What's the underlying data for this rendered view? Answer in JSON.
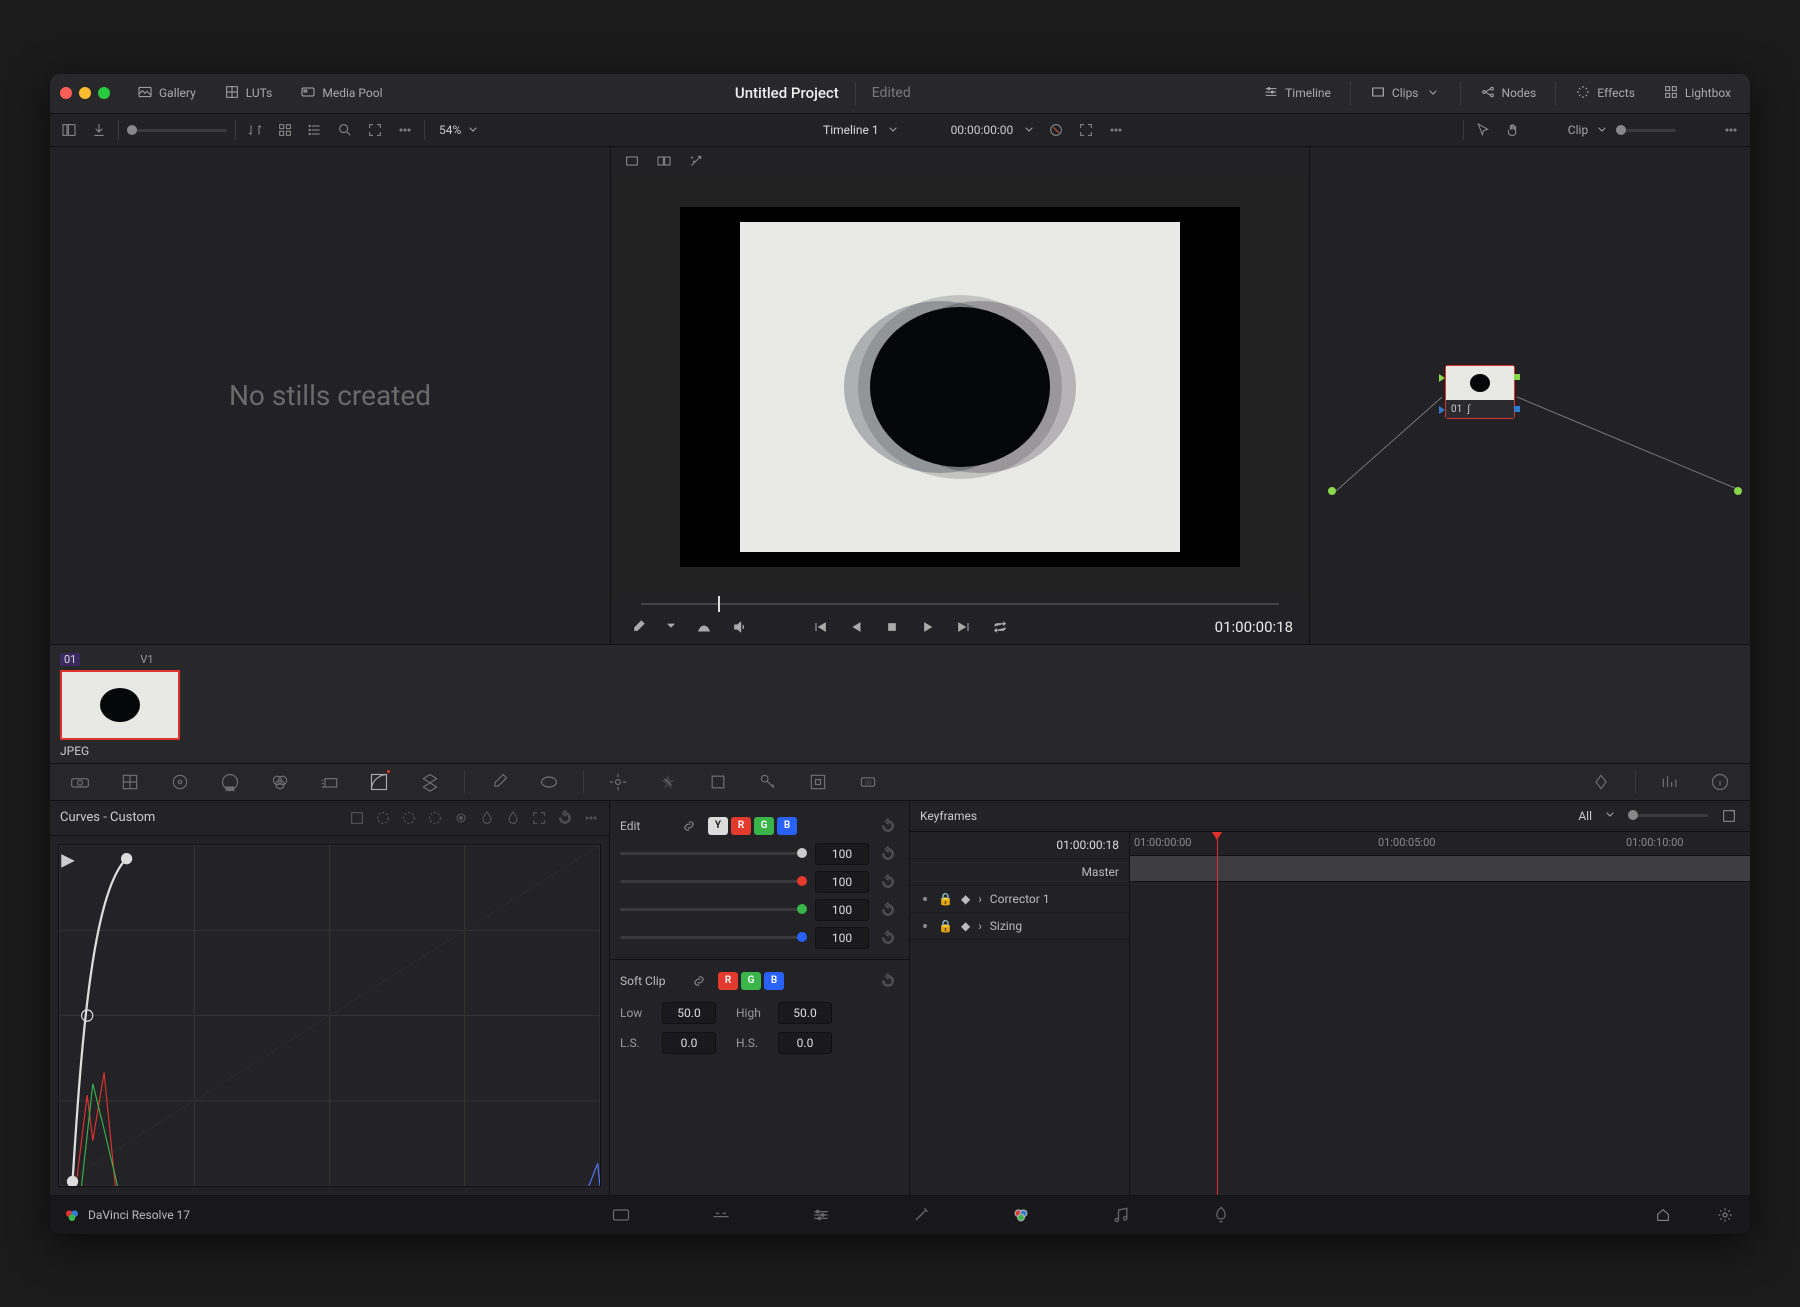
{
  "project": {
    "title": "Untitled Project",
    "status": "Edited"
  },
  "titlebar": {
    "gallery": "Gallery",
    "luts": "LUTs",
    "mediapool": "Media Pool",
    "timeline": "Timeline",
    "clips": "Clips",
    "nodes": "Nodes",
    "effects": "Effects",
    "lightbox": "Lightbox"
  },
  "subbar": {
    "zoom": "54%",
    "timeline_name": "Timeline 1",
    "clip_sel": "Clip",
    "timecode": "00:00:00:00"
  },
  "gallery": {
    "empty": "No stills created"
  },
  "viewer": {
    "tc": "01:00:00:18"
  },
  "node": {
    "id": "01"
  },
  "clipstrip": {
    "badge": "01",
    "track": "V1",
    "caption": "JPEG"
  },
  "curves": {
    "title": "Curves - Custom",
    "edit_label": "Edit",
    "softclip_label": "Soft Clip",
    "channels": [
      "Y",
      "R",
      "G",
      "B"
    ],
    "value_lum": "100",
    "value_r": "100",
    "value_g": "100",
    "value_b": "100",
    "low_label": "Low",
    "low": "50.0",
    "high_label": "High",
    "high": "50.0",
    "ls_label": "L.S.",
    "ls": "0.0",
    "hs_label": "H.S.",
    "hs": "0.0"
  },
  "keyframes": {
    "title": "Keyframes",
    "filter": "All",
    "current_tc": "01:00:00:18",
    "ruler": [
      "01:00:00:00",
      "01:00:05:00",
      "01:00:10:00"
    ],
    "master": "Master",
    "tracks": [
      "Corrector 1",
      "Sizing"
    ]
  },
  "footer": {
    "brand": "DaVinci Resolve 17"
  }
}
